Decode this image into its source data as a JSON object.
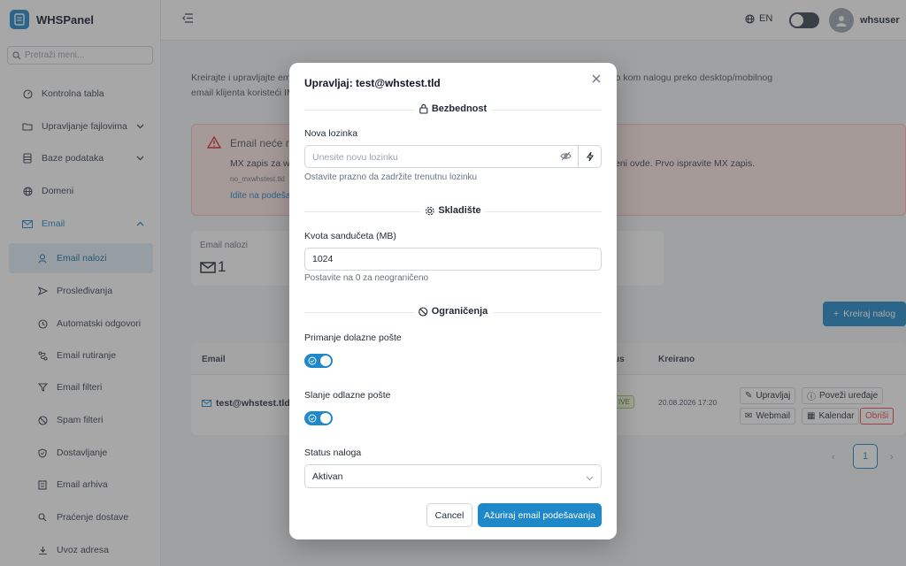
{
  "app": {
    "name": "WHSPanel"
  },
  "sidebar": {
    "search_placeholder": "Pretraži meni...",
    "items": [
      {
        "label": "Kontrolna tabla",
        "icon": "dashboard-icon"
      },
      {
        "label": "Upravljanje fajlovima",
        "icon": "folder-icon"
      },
      {
        "label": "Baze podataka",
        "icon": "database-icon"
      },
      {
        "label": "Domeni",
        "icon": "globe-icon"
      },
      {
        "label": "Email",
        "icon": "mail-icon"
      },
      {
        "label": "Email nalozi",
        "icon": "user-icon"
      },
      {
        "label": "Prosleđivanja",
        "icon": "send-icon"
      },
      {
        "label": "Automatski odgovori",
        "icon": "clock-icon"
      },
      {
        "label": "Email rutiranje",
        "icon": "route-icon"
      },
      {
        "label": "Email filteri",
        "icon": "filter-icon"
      },
      {
        "label": "Spam filteri",
        "icon": "block-icon"
      },
      {
        "label": "Dostavljanje",
        "icon": "shield-icon"
      },
      {
        "label": "Email arhiva",
        "icon": "archive-icon"
      },
      {
        "label": "Praćenje dostave",
        "icon": "search-icon"
      },
      {
        "label": "Uvoz adresa",
        "icon": "import-icon"
      }
    ]
  },
  "topbar": {
    "language": "EN",
    "username": "whsuser"
  },
  "page": {
    "description_line1": "Kreirajte i upravljajte ema                                                                             skladišta. Možete pristupiti bilo kom nalogu preko desktop/mobilnog",
    "description_line2": "email klijenta koristeći IM                                                                               onfiguracije.",
    "alert": {
      "title": "Email neće ra",
      "line1": "MX zapis za wh",
      "line1_right": "eni ovde. Prvo ispravite MX zapis.",
      "line2": "no_mxwhstest.tld",
      "link": "Idite na podeša"
    },
    "stat": {
      "label": "Email nalozi",
      "value": "1"
    },
    "create_button": "Kreiraj nalog",
    "table": {
      "col_email": "Email",
      "col_status": "us",
      "col_created": "Kreirano",
      "row": {
        "email": "test@whstest.tld",
        "status": "IVE",
        "created": "20.08.2026 17:20",
        "actions": {
          "manage": "Upravljaj",
          "connect": "Poveži uređaje",
          "webmail": "Webmail",
          "calendar": "Kalendar",
          "delete": "Obriši"
        }
      }
    },
    "pagination": {
      "current": "1",
      "prev": "‹",
      "next": "›"
    }
  },
  "modal": {
    "title": "Upravljaj: test@whstest.tld",
    "security": {
      "heading": "Bezbednost",
      "password_label": "Nova lozinka",
      "password_placeholder": "Unesite novu lozinku",
      "password_help": "Ostavite prazno da zadržite trenutnu lozinku"
    },
    "storage": {
      "heading": "Skladište",
      "quota_label": "Kvota sandučeta (MB)",
      "quota_value": "1024",
      "quota_help": "Postavite na 0 za neograničeno"
    },
    "limits": {
      "heading": "Ograničenja",
      "incoming_label": "Primanje dolazne pošte",
      "incoming_enabled": true,
      "outgoing_label": "Slanje odlazne pošte",
      "outgoing_enabled": true
    },
    "status": {
      "label": "Status naloga",
      "value": "Aktivan"
    },
    "cancel": "Cancel",
    "submit": "Ažuriraj email podešavanja"
  },
  "colors": {
    "accent": "#1e88c9",
    "danger": "#ef4444",
    "overlay": "rgba(60,60,60,0.45)"
  }
}
